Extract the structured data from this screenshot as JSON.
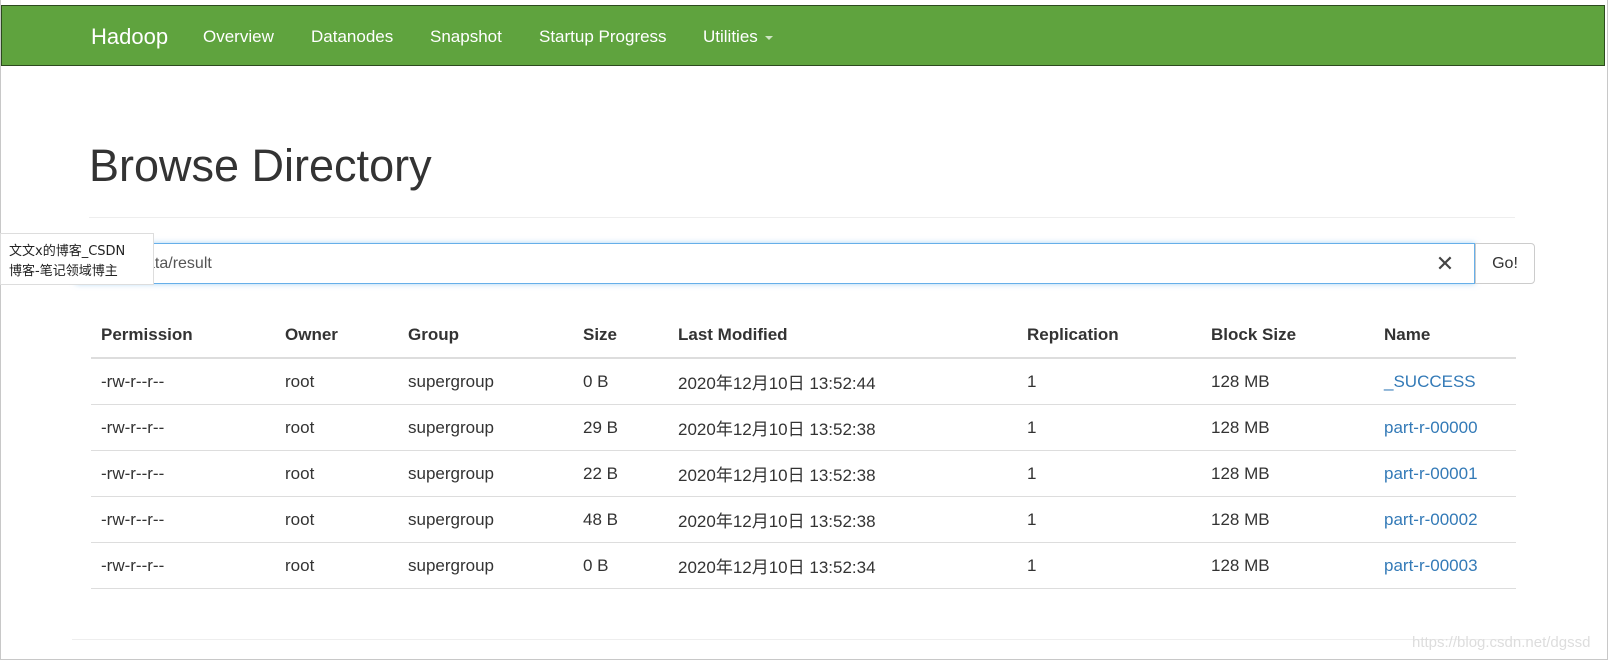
{
  "navbar": {
    "brand": "Hadoop",
    "items": [
      {
        "label": "Overview"
      },
      {
        "label": "Datanodes"
      },
      {
        "label": "Snapshot"
      },
      {
        "label": "Startup Progress"
      },
      {
        "label": "Utilities"
      }
    ],
    "background_color": "#5fa33e"
  },
  "page": {
    "title": "Browse Directory"
  },
  "search": {
    "value": "ata/result",
    "go_label": "Go!",
    "clear_icon": "close-icon"
  },
  "overlay": {
    "line1": "文文x的博客_CSDN",
    "line2": "博客-笔记领域博主"
  },
  "table": {
    "headers": [
      "Permission",
      "Owner",
      "Group",
      "Size",
      "Last Modified",
      "Replication",
      "Block Size",
      "Name"
    ],
    "rows": [
      {
        "permission": "-rw-r--r--",
        "owner": "root",
        "group": "supergroup",
        "size": "0 B",
        "modified": "2020年12月10日 13:52:44",
        "replication": "1",
        "block_size": "128 MB",
        "name": "_SUCCESS"
      },
      {
        "permission": "-rw-r--r--",
        "owner": "root",
        "group": "supergroup",
        "size": "29 B",
        "modified": "2020年12月10日 13:52:38",
        "replication": "1",
        "block_size": "128 MB",
        "name": "part-r-00000"
      },
      {
        "permission": "-rw-r--r--",
        "owner": "root",
        "group": "supergroup",
        "size": "22 B",
        "modified": "2020年12月10日 13:52:38",
        "replication": "1",
        "block_size": "128 MB",
        "name": "part-r-00001"
      },
      {
        "permission": "-rw-r--r--",
        "owner": "root",
        "group": "supergroup",
        "size": "48 B",
        "modified": "2020年12月10日 13:52:38",
        "replication": "1",
        "block_size": "128 MB",
        "name": "part-r-00002"
      },
      {
        "permission": "-rw-r--r--",
        "owner": "root",
        "group": "supergroup",
        "size": "0 B",
        "modified": "2020年12月10日 13:52:34",
        "replication": "1",
        "block_size": "128 MB",
        "name": "part-r-00003"
      }
    ],
    "link_color": "#337ab7"
  },
  "watermark": "https://blog.csdn.net/dgssd"
}
